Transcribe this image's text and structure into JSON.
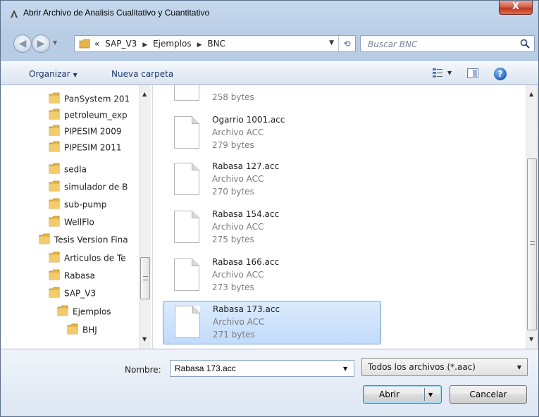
{
  "window": {
    "title": "Abrir Archivo de Analisis Cualitativo y Cuantitativo",
    "close_label": "X"
  },
  "address": {
    "prefix": "«",
    "crumbs": [
      "SAP_V3",
      "Ejemplos",
      "BNC"
    ],
    "search_placeholder": "Buscar BNC"
  },
  "toolbar": {
    "organize_label": "Organizar",
    "new_folder_label": "Nueva carpeta"
  },
  "nav_tree": [
    {
      "label": "PanSystem 201"
    },
    {
      "label": "petroleum_exp"
    },
    {
      "label": "PIPESIM 2009"
    },
    {
      "label": "PIPESIM 2011"
    },
    {
      "label": "sedla"
    },
    {
      "label": "simulador de B"
    },
    {
      "label": "sub-pump"
    },
    {
      "label": "WellFlo"
    },
    {
      "label": "Tesis Version Fina"
    },
    {
      "label": "Articulos de Te"
    },
    {
      "label": "Rabasa"
    },
    {
      "label": "SAP_V3"
    },
    {
      "label": "Ejemplos"
    },
    {
      "label": "BHJ"
    }
  ],
  "files": [
    {
      "name": "",
      "type": "",
      "size": "258 bytes",
      "selected": false
    },
    {
      "name": "Ogarrio 1001.acc",
      "type": "Archivo ACC",
      "size": "279 bytes",
      "selected": false
    },
    {
      "name": "Rabasa 127.acc",
      "type": "Archivo ACC",
      "size": "270 bytes",
      "selected": false
    },
    {
      "name": "Rabasa 154.acc",
      "type": "Archivo ACC",
      "size": "275 bytes",
      "selected": false
    },
    {
      "name": "Rabasa 166.acc",
      "type": "Archivo ACC",
      "size": "273 bytes",
      "selected": false
    },
    {
      "name": "Rabasa 173.acc",
      "type": "Archivo ACC",
      "size": "271 bytes",
      "selected": true
    }
  ],
  "footer": {
    "filename_label": "Nombre:",
    "filename_value": "Rabasa 173.acc",
    "filter_value": "Todos los archivos (*.aac)",
    "open_label": "Abrir",
    "cancel_label": "Cancelar"
  },
  "colors": {
    "selection": "#c1dbfc",
    "folder": "#e8b54a",
    "close_button": "#c0341d"
  }
}
